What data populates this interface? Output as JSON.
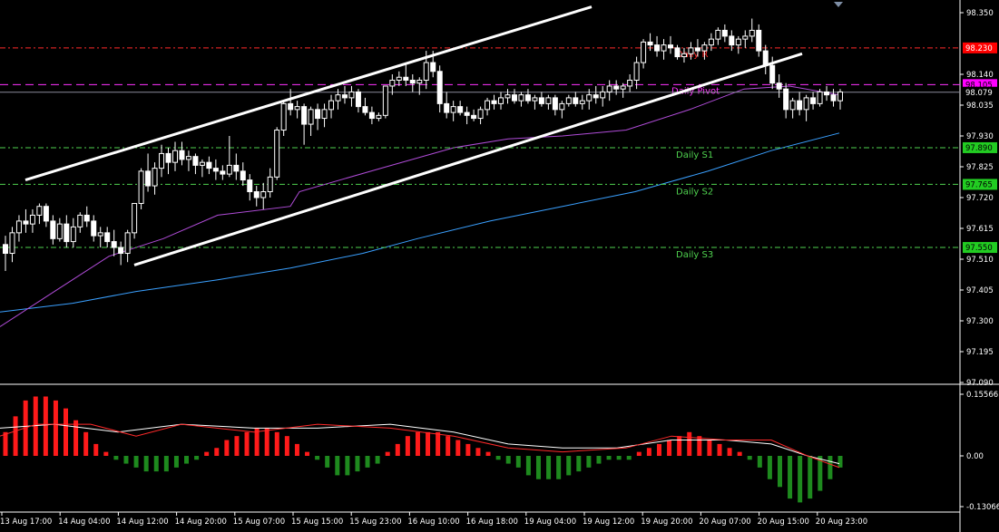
{
  "chart_data": [
    {
      "type": "candlestick",
      "title": "",
      "ylim": [
        97.09,
        98.35
      ],
      "price_ticks": [
        "98.350",
        "98.140",
        "98.035",
        "97.930",
        "97.825",
        "97.720",
        "97.615",
        "97.510",
        "97.405",
        "97.300",
        "97.195",
        "97.090"
      ],
      "time_labels": [
        "13 Aug 17:00",
        "14 Aug 04:00",
        "14 Aug 12:00",
        "14 Aug 20:00",
        "15 Aug 07:00",
        "15 Aug 15:00",
        "15 Aug 23:00",
        "16 Aug 10:00",
        "16 Aug 18:00",
        "19 Aug 04:00",
        "19 Aug 12:00",
        "19 Aug 20:00",
        "20 Aug 07:00",
        "20 Aug 15:00",
        "20 Aug 23:00"
      ],
      "levels": [
        {
          "name": "Daily R1",
          "price": 98.23,
          "tag": "98.230",
          "color": "#ff2a2a",
          "style": "dashdot",
          "label": "Daily R",
          "tag_bg": "#ff0000",
          "tag_fg": "#ffffff"
        },
        {
          "name": "Daily Pivot",
          "price": 98.105,
          "tag": "98.105",
          "color": "#ff33ff",
          "style": "dash",
          "label": "Daily Pivot",
          "tag_bg": "#ff00ff",
          "tag_fg": "#000000"
        },
        {
          "name": "Daily S1",
          "price": 97.89,
          "tag": "97.890",
          "color": "#4fd24f",
          "style": "dashdot",
          "label": "Daily S1",
          "tag_bg": "#22cc22",
          "tag_fg": "#000000"
        },
        {
          "name": "Daily S2",
          "price": 97.765,
          "tag": "97.765",
          "color": "#4fd24f",
          "style": "dashdot",
          "label": "Daily S2",
          "tag_bg": "#22cc22",
          "tag_fg": "#000000"
        },
        {
          "name": "Daily S3",
          "price": 97.55,
          "tag": "97.550",
          "color": "#4fd24f",
          "style": "dashdot",
          "label": "Daily S3",
          "tag_bg": "#22cc22",
          "tag_fg": "#000000"
        }
      ],
      "current_price": "98.079",
      "candles": [
        [
          97.56,
          97.59,
          97.47,
          97.53
        ],
        [
          97.53,
          97.62,
          97.5,
          97.6
        ],
        [
          97.6,
          97.66,
          97.57,
          97.64
        ],
        [
          97.64,
          97.68,
          97.6,
          97.63
        ],
        [
          97.63,
          97.68,
          97.6,
          97.66
        ],
        [
          97.66,
          97.7,
          97.63,
          97.69
        ],
        [
          97.69,
          97.7,
          97.62,
          97.64
        ],
        [
          97.64,
          97.66,
          97.56,
          97.58
        ],
        [
          97.58,
          97.65,
          97.57,
          97.63
        ],
        [
          97.63,
          97.66,
          97.55,
          97.57
        ],
        [
          97.57,
          97.65,
          97.55,
          97.62
        ],
        [
          97.62,
          97.67,
          97.6,
          97.66
        ],
        [
          97.66,
          97.69,
          97.62,
          97.64
        ],
        [
          97.64,
          97.66,
          97.57,
          97.59
        ],
        [
          97.59,
          97.62,
          97.55,
          97.6
        ],
        [
          97.6,
          97.62,
          97.55,
          97.57
        ],
        [
          97.57,
          97.61,
          97.52,
          97.55
        ],
        [
          97.55,
          97.57,
          97.49,
          97.53
        ],
        [
          97.53,
          97.61,
          97.5,
          97.6
        ],
        [
          97.6,
          97.7,
          97.58,
          97.7
        ],
        [
          97.7,
          97.82,
          97.68,
          97.81
        ],
        [
          97.81,
          97.87,
          97.74,
          97.76
        ],
        [
          97.76,
          97.84,
          97.73,
          97.82
        ],
        [
          97.82,
          97.9,
          97.79,
          97.87
        ],
        [
          97.87,
          97.89,
          97.8,
          97.84
        ],
        [
          97.84,
          97.91,
          97.81,
          97.88
        ],
        [
          97.88,
          97.91,
          97.83,
          97.85
        ],
        [
          97.85,
          97.88,
          97.81,
          97.86
        ],
        [
          97.86,
          97.87,
          97.8,
          97.83
        ],
        [
          97.83,
          97.85,
          97.79,
          97.84
        ],
        [
          97.84,
          97.86,
          97.8,
          97.82
        ],
        [
          97.82,
          97.85,
          97.78,
          97.81
        ],
        [
          97.81,
          97.83,
          97.78,
          97.8
        ],
        [
          97.8,
          97.93,
          97.79,
          97.83
        ],
        [
          97.83,
          97.87,
          97.78,
          97.81
        ],
        [
          97.81,
          97.84,
          97.76,
          97.78
        ],
        [
          97.78,
          97.8,
          97.71,
          97.74
        ],
        [
          97.74,
          97.76,
          97.69,
          97.72
        ],
        [
          97.72,
          97.77,
          97.68,
          97.74
        ],
        [
          97.74,
          97.82,
          97.72,
          97.79
        ],
        [
          97.79,
          97.96,
          97.78,
          97.95
        ],
        [
          97.95,
          98.05,
          97.93,
          98.04
        ],
        [
          98.04,
          98.09,
          98.0,
          98.02
        ],
        [
          98.02,
          98.05,
          97.99,
          98.03
        ],
        [
          98.03,
          98.04,
          97.9,
          97.97
        ],
        [
          97.97,
          98.03,
          97.93,
          98.02
        ],
        [
          98.02,
          98.04,
          97.95,
          97.99
        ],
        [
          97.99,
          98.04,
          97.96,
          98.02
        ],
        [
          98.02,
          98.07,
          97.99,
          98.05
        ],
        [
          98.05,
          98.09,
          98.02,
          98.07
        ],
        [
          98.07,
          98.1,
          98.04,
          98.06
        ],
        [
          98.06,
          98.1,
          98.03,
          98.08
        ],
        [
          98.08,
          98.09,
          98.01,
          98.03
        ],
        [
          98.03,
          98.06,
          98.0,
          98.01
        ],
        [
          98.01,
          98.03,
          97.97,
          97.99
        ],
        [
          97.99,
          98.01,
          97.98,
          98.0
        ],
        [
          98.0,
          98.1,
          97.99,
          98.1
        ],
        [
          98.1,
          98.14,
          98.07,
          98.12
        ],
        [
          98.12,
          98.15,
          98.1,
          98.13
        ],
        [
          98.13,
          98.18,
          98.1,
          98.12
        ],
        [
          98.12,
          98.14,
          98.08,
          98.11
        ],
        [
          98.11,
          98.13,
          98.07,
          98.12
        ],
        [
          98.12,
          98.22,
          98.09,
          98.18
        ],
        [
          98.18,
          98.22,
          98.13,
          98.15
        ],
        [
          98.15,
          98.17,
          98.01,
          98.04
        ],
        [
          98.04,
          98.08,
          97.99,
          98.01
        ],
        [
          98.01,
          98.05,
          97.98,
          98.03
        ],
        [
          98.03,
          98.05,
          98.0,
          98.01
        ],
        [
          98.01,
          98.03,
          97.97,
          98.0
        ],
        [
          98.0,
          98.02,
          97.98,
          97.99
        ],
        [
          97.99,
          98.03,
          97.97,
          98.02
        ],
        [
          98.02,
          98.06,
          98.0,
          98.05
        ],
        [
          98.05,
          98.07,
          98.02,
          98.04
        ],
        [
          98.04,
          98.08,
          98.02,
          98.06
        ],
        [
          98.06,
          98.09,
          98.04,
          98.07
        ],
        [
          98.07,
          98.09,
          98.04,
          98.05
        ],
        [
          98.05,
          98.08,
          98.03,
          98.07
        ],
        [
          98.07,
          98.09,
          98.04,
          98.05
        ],
        [
          98.05,
          98.07,
          98.02,
          98.06
        ],
        [
          98.06,
          98.08,
          98.03,
          98.04
        ],
        [
          98.04,
          98.07,
          98.02,
          98.06
        ],
        [
          98.06,
          98.07,
          98.0,
          98.02
        ],
        [
          98.02,
          98.05,
          97.99,
          98.04
        ],
        [
          98.04,
          98.07,
          98.03,
          98.06
        ],
        [
          98.06,
          98.08,
          98.03,
          98.04
        ],
        [
          98.04,
          98.07,
          98.02,
          98.05
        ],
        [
          98.05,
          98.09,
          98.02,
          98.07
        ],
        [
          98.07,
          98.1,
          98.04,
          98.06
        ],
        [
          98.06,
          98.1,
          98.03,
          98.08
        ],
        [
          98.08,
          98.12,
          98.05,
          98.1
        ],
        [
          98.1,
          98.12,
          98.07,
          98.09
        ],
        [
          98.09,
          98.11,
          98.06,
          98.1
        ],
        [
          98.1,
          98.14,
          98.08,
          98.12
        ],
        [
          98.12,
          98.2,
          98.09,
          98.18
        ],
        [
          98.18,
          98.26,
          98.16,
          98.25
        ],
        [
          98.25,
          98.28,
          98.22,
          98.24
        ],
        [
          98.24,
          98.27,
          98.2,
          98.22
        ],
        [
          98.22,
          98.26,
          98.19,
          98.24
        ],
        [
          98.24,
          98.27,
          98.21,
          98.23
        ],
        [
          98.23,
          98.24,
          98.19,
          98.2
        ],
        [
          98.2,
          98.23,
          98.18,
          98.21
        ],
        [
          98.21,
          98.25,
          98.19,
          98.23
        ],
        [
          98.23,
          98.26,
          98.2,
          98.22
        ],
        [
          98.22,
          98.25,
          98.19,
          98.24
        ],
        [
          98.24,
          98.28,
          98.22,
          98.26
        ],
        [
          98.26,
          98.3,
          98.24,
          98.29
        ],
        [
          98.29,
          98.31,
          98.25,
          98.27
        ],
        [
          98.27,
          98.29,
          98.22,
          98.24
        ],
        [
          98.24,
          98.27,
          98.21,
          98.26
        ],
        [
          98.26,
          98.29,
          98.23,
          98.27
        ],
        [
          98.27,
          98.33,
          98.25,
          98.29
        ],
        [
          98.29,
          98.31,
          98.2,
          98.22
        ],
        [
          98.22,
          98.24,
          98.14,
          98.17
        ],
        [
          98.17,
          98.2,
          98.09,
          98.11
        ],
        [
          98.11,
          98.14,
          98.06,
          98.09
        ],
        [
          98.09,
          98.11,
          97.99,
          98.02
        ],
        [
          98.02,
          98.06,
          97.99,
          98.05
        ],
        [
          98.05,
          98.08,
          98.0,
          98.02
        ],
        [
          98.02,
          98.07,
          97.98,
          98.06
        ],
        [
          98.06,
          98.08,
          98.02,
          98.04
        ],
        [
          98.04,
          98.09,
          98.03,
          98.08
        ],
        [
          98.08,
          98.1,
          98.05,
          98.07
        ],
        [
          98.07,
          98.09,
          98.03,
          98.05
        ],
        [
          98.05,
          98.09,
          98.02,
          98.08
        ]
      ],
      "ema_fast": [
        [
          0,
          97.28
        ],
        [
          60,
          97.4
        ],
        [
          120,
          97.52
        ],
        [
          180,
          97.58
        ],
        [
          240,
          97.66
        ],
        [
          320,
          97.69
        ],
        [
          330,
          97.74
        ],
        [
          420,
          97.82
        ],
        [
          500,
          97.89
        ],
        [
          560,
          97.92
        ],
        [
          620,
          97.93
        ],
        [
          690,
          97.95
        ],
        [
          760,
          98.02
        ],
        [
          820,
          98.09
        ],
        [
          870,
          98.1
        ],
        [
          925,
          98.07
        ]
      ],
      "ema_slow": [
        [
          0,
          97.33
        ],
        [
          80,
          97.36
        ],
        [
          150,
          97.4
        ],
        [
          240,
          97.44
        ],
        [
          320,
          97.48
        ],
        [
          400,
          97.53
        ],
        [
          460,
          97.58
        ],
        [
          540,
          97.64
        ],
        [
          620,
          97.69
        ],
        [
          700,
          97.74
        ],
        [
          780,
          97.81
        ],
        [
          850,
          97.88
        ],
        [
          925,
          97.94
        ]
      ],
      "channel_lines": [
        {
          "from": [
            28,
            97.78
          ],
          "to": [
            652,
            98.37
          ]
        },
        {
          "from": [
            148,
            97.49
          ],
          "to": [
            884,
            98.21
          ]
        }
      ]
    },
    {
      "type": "histogram",
      "title": "",
      "ticks": [
        "0.15566",
        "0.00",
        "-0.13066"
      ],
      "ylim": [
        -0.13066,
        0.15566
      ],
      "bars": [
        0.06,
        0.1,
        0.14,
        0.15,
        0.15,
        0.14,
        0.12,
        0.09,
        0.06,
        0.03,
        0.01,
        -0.01,
        -0.02,
        -0.03,
        -0.04,
        -0.04,
        -0.04,
        -0.03,
        -0.02,
        -0.01,
        0.01,
        0.02,
        0.04,
        0.05,
        0.06,
        0.07,
        0.07,
        0.06,
        0.05,
        0.03,
        0.01,
        -0.01,
        -0.03,
        -0.05,
        -0.05,
        -0.04,
        -0.03,
        -0.02,
        0.01,
        0.03,
        0.05,
        0.06,
        0.06,
        0.06,
        0.05,
        0.04,
        0.03,
        0.02,
        0.01,
        -0.01,
        -0.02,
        -0.03,
        -0.05,
        -0.06,
        -0.06,
        -0.06,
        -0.05,
        -0.04,
        -0.03,
        -0.02,
        -0.01,
        -0.01,
        -0.01,
        0.01,
        0.02,
        0.03,
        0.04,
        0.05,
        0.06,
        0.05,
        0.04,
        0.03,
        0.02,
        0.01,
        -0.01,
        -0.03,
        -0.06,
        -0.08,
        -0.11,
        -0.12,
        -0.11,
        -0.09,
        -0.06,
        -0.03
      ],
      "signal_line": [
        [
          0,
          0.07
        ],
        [
          60,
          0.08
        ],
        [
          130,
          0.06
        ],
        [
          200,
          0.08
        ],
        [
          280,
          0.07
        ],
        [
          350,
          0.07
        ],
        [
          430,
          0.08
        ],
        [
          500,
          0.06
        ],
        [
          560,
          0.03
        ],
        [
          620,
          0.02
        ],
        [
          680,
          0.02
        ],
        [
          740,
          0.04
        ],
        [
          800,
          0.04
        ],
        [
          850,
          0.03
        ],
        [
          890,
          0.0
        ],
        [
          925,
          -0.02
        ]
      ],
      "main_line": [
        [
          0,
          0.05
        ],
        [
          40,
          0.08
        ],
        [
          100,
          0.08
        ],
        [
          150,
          0.05
        ],
        [
          200,
          0.08
        ],
        [
          280,
          0.06
        ],
        [
          350,
          0.08
        ],
        [
          430,
          0.07
        ],
        [
          500,
          0.05
        ],
        [
          560,
          0.02
        ],
        [
          620,
          0.01
        ],
        [
          690,
          0.02
        ],
        [
          740,
          0.05
        ],
        [
          800,
          0.04
        ],
        [
          850,
          0.04
        ],
        [
          890,
          0.0
        ],
        [
          925,
          -0.03
        ]
      ]
    }
  ]
}
